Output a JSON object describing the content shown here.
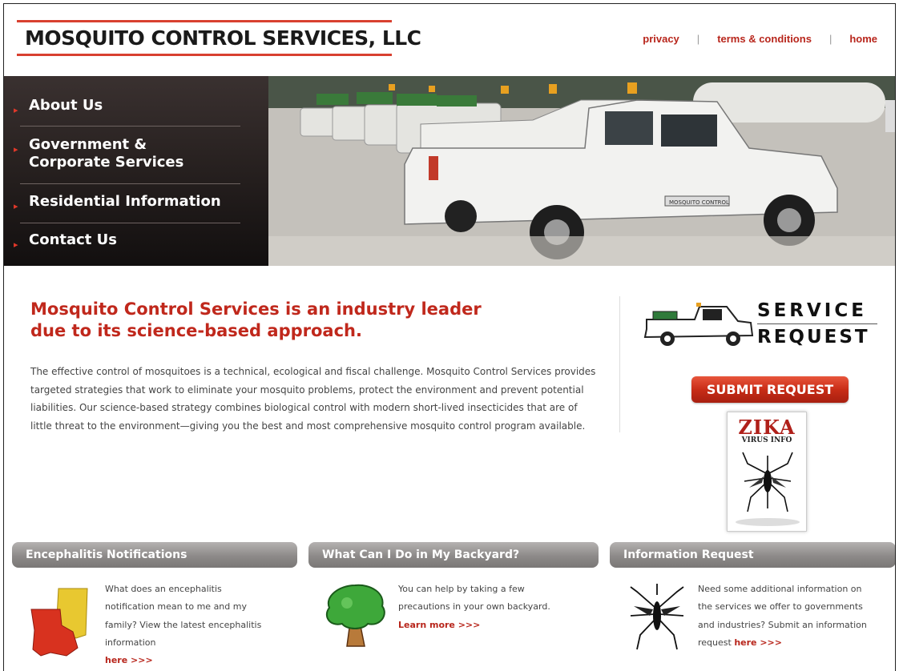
{
  "header": {
    "logo_text": "MOSQUITO CONTROL SERVICES, LLC",
    "links": {
      "privacy": "privacy",
      "terms": "terms & conditions",
      "home": "home",
      "separator": "|"
    }
  },
  "nav": {
    "items": [
      {
        "label": "About Us"
      },
      {
        "label_line1": "Government &",
        "label_line2": "Corporate Services"
      },
      {
        "label": "Residential Information"
      },
      {
        "label": "Contact Us"
      }
    ]
  },
  "hero": {
    "truck_door_label": "MOSQUITO CONTROL"
  },
  "main": {
    "headline_line1": "Mosquito Control Services is an industry leader",
    "headline_line2": "due to its science-based approach.",
    "paragraph": "The effective control of mosquitoes is a technical, ecological and fiscal challenge. Mosquito Control Services provides targeted strategies that work to eliminate your mosquito problems, protect the environment and prevent potential liabilities. Our science-based strategy combines biological control with modern short-lived insecticides that are of little threat to the environment—giving you the best and most comprehensive mosquito control program available."
  },
  "sidebar": {
    "service_line1": "SERVICE",
    "service_line2": "REQUEST",
    "submit_label": "SUBMIT REQUEST",
    "zika_title": "ZIKA",
    "zika_sub": "VIRUS INFO"
  },
  "boxes": [
    {
      "title": "Encephalitis Notifications",
      "text_lines": [
        "What does an encephalitis",
        "notification mean to me and my",
        "family? View the latest encephalitis",
        "information"
      ],
      "link": "here >>>"
    },
    {
      "title": "What Can I Do in My Backyard?",
      "text_lines": [
        "You can help by taking a few",
        "precautions in your own backyard."
      ],
      "link": "Learn more >>>"
    },
    {
      "title": "Information Request",
      "text_lines": [
        "Need some additional information on",
        "the services we offer to governments",
        "and industries? Submit an information"
      ],
      "text_last": "request",
      "link": "here >>>"
    }
  ],
  "colors": {
    "brand_red": "#c0281c",
    "link_red": "#b8261c",
    "nav_bg": "#2a2322",
    "box_header": "#8d8a89"
  }
}
